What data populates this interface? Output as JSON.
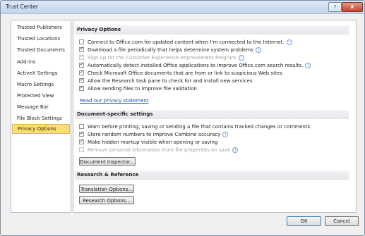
{
  "window": {
    "title": "Trust Center",
    "help_label": "?",
    "close_label": "X"
  },
  "sidebar": {
    "items": [
      {
        "label": "Trusted Publishers",
        "active": false
      },
      {
        "label": "Trusted Locations",
        "active": false
      },
      {
        "label": "Trusted Documents",
        "active": false
      },
      {
        "label": "Add-ins",
        "active": false
      },
      {
        "label": "ActiveX Settings",
        "active": false
      },
      {
        "label": "Macro Settings",
        "active": false
      },
      {
        "label": "Protected View",
        "active": false
      },
      {
        "label": "Message Bar",
        "active": false
      },
      {
        "label": "File Block Settings",
        "active": false
      },
      {
        "label": "Privacy Options",
        "active": true
      }
    ]
  },
  "privacy": {
    "heading": "Privacy Options",
    "options": [
      {
        "label": "Connect to Office.com for updated content when I'm connected to the Internet.",
        "checked": false,
        "disabled": false,
        "info": true
      },
      {
        "label": "Download a file periodically that helps determine system problems",
        "checked": true,
        "disabled": false,
        "info": true
      },
      {
        "label": "Sign up for the Customer Experience Improvement Program",
        "checked": true,
        "disabled": true,
        "info": true
      },
      {
        "label": "Automatically detect installed Office applications to improve Office.com search results.",
        "checked": true,
        "disabled": false,
        "info": true
      },
      {
        "label": "Check Microsoft Office documents that are from or link to suspicious Web sites",
        "checked": true,
        "disabled": false,
        "info": false
      },
      {
        "label": "Allow the Research task pane to check for and install new services",
        "checked": true,
        "disabled": false,
        "info": false
      },
      {
        "label": "Allow sending files to improve file validation",
        "checked": true,
        "disabled": false,
        "info": false
      }
    ],
    "link": "Read our privacy statement"
  },
  "document": {
    "heading": "Document-specific settings",
    "options": [
      {
        "label": "Warn before printing, saving or sending a file that contains tracked changes or comments",
        "checked": false,
        "disabled": false,
        "info": false
      },
      {
        "label": "Store random numbers to improve Combine accuracy",
        "checked": true,
        "disabled": false,
        "info": true
      },
      {
        "label": "Make hidden markup visible when opening or saving",
        "checked": true,
        "disabled": false,
        "info": false
      },
      {
        "label": "Remove personal information from file properties on save",
        "checked": false,
        "disabled": true,
        "info": true
      }
    ],
    "inspector_button": "Document Inspector..."
  },
  "research": {
    "heading": "Research & Reference",
    "translation_button": "Translation Options...",
    "research_button": "Research Options..."
  },
  "footer": {
    "ok_label": "OK",
    "cancel_label": "Cancel"
  }
}
